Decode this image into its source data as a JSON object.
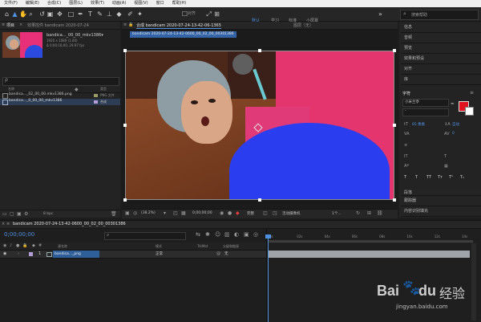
{
  "menu": [
    "文件(F)",
    "编辑(E)",
    "合成(C)",
    "图层(L)",
    "效果(T)",
    "动画(A)",
    "视图(V)",
    "窗口",
    "帮助(H)"
  ],
  "toolbar": {
    "snap_label": "对齐",
    "workspaces": [
      "默认",
      "学习",
      "标准",
      "小屏幕"
    ],
    "active_workspace": "默认",
    "search_placeholder": "搜索帮助"
  },
  "project": {
    "tab": "项目",
    "fx_tab": "效果控件 bandicam 2020-07-24",
    "file_name": "bandica..._00_00_mkv1386▾",
    "file_meta_1": "1920 x 1080 (1.00)",
    "file_meta_2": "Δ 0;00;16;00, 29.97 fps",
    "search_glyph": "ρ",
    "col_name": "名称",
    "col_type": "类型",
    "items": [
      {
        "name": "bandica..._02_00_00.mkv1386.png",
        "type": "PNG 文件"
      },
      {
        "name": "bandica..._0_00_00_mkv1386",
        "type": "合成"
      }
    ],
    "footer_bpc": "8 bpc"
  },
  "composition": {
    "tab_label": "合成 bandicam 2020-07-24-13-42-06-1365",
    "crumb": "bandicam 2020-07-24-13-42-0600_00_02_00_00301386",
    "layer_tab": "图层（无）",
    "zoom": "(38.2%)",
    "timecode": "0;00;00;00",
    "quality": "完整",
    "camera": "活动摄像机",
    "views": "1个..."
  },
  "right_panel": {
    "items_top": [
      "信息",
      "音频",
      "预览",
      "效果和预设",
      "对齐",
      "库"
    ],
    "char_title": "字符",
    "font_name": "小米兰亭",
    "font_style": "-",
    "size_label": "85 像素",
    "leading_label": "自动",
    "tracking_label": "0",
    "fill_color": "#e0141e",
    "stroke_color": "#ffffff",
    "style_buttons": [
      "T",
      "T",
      "TT",
      "Tт",
      "T¹",
      "T₁"
    ],
    "paragraph_label": "段落",
    "items_bottom": [
      "跟踪器",
      "内容识别填充"
    ]
  },
  "timeline": {
    "tab": "bandicam 2020-07-24-13-42-0600_00_02_00_00301386",
    "timecode": "0;00;00;00",
    "col_source": "源名称",
    "col_mode": "模式",
    "col_trk": "TrkMat",
    "col_parent": "父级和链接",
    "layer_num": "1",
    "layer_name": "bandica..._png",
    "layer_mode": "正常",
    "layer_parent": "无",
    "ruler": [
      "0s",
      "02s",
      "04s",
      "06s",
      "08s",
      "10s",
      "12s",
      "14s"
    ]
  },
  "watermark": {
    "brand_a": "Bai",
    "brand_b": "du",
    "brand_c": "经验",
    "url": "jingyan.baidu.com"
  }
}
